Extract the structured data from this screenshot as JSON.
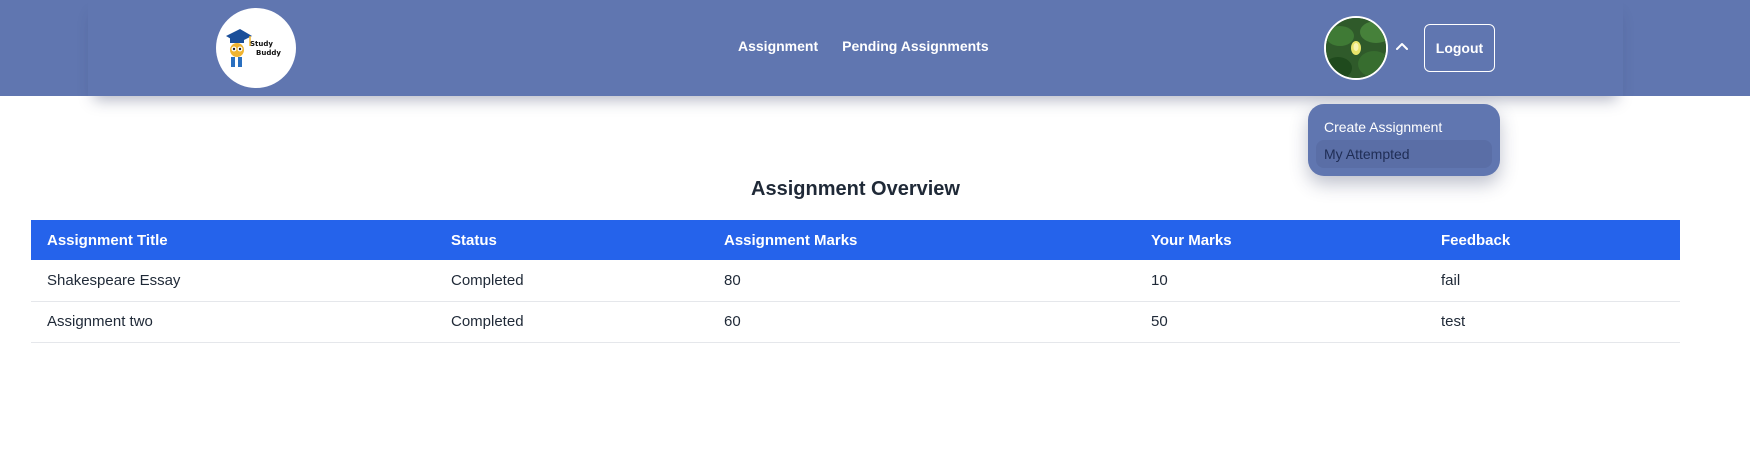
{
  "logo": {
    "line1": "Study",
    "line2": "Buddy",
    "icon": "graduation-cap-owl-icon"
  },
  "nav": {
    "links": [
      {
        "label": "Assignment"
      },
      {
        "label": "Pending Assignments"
      }
    ]
  },
  "user": {
    "avatar_icon": "user-avatar-photo",
    "chevron_icon": "chevron-up-icon",
    "logout_label": "Logout"
  },
  "dropdown": {
    "items": [
      {
        "label": "Create Assignment"
      },
      {
        "label": "My Attempted"
      }
    ]
  },
  "page": {
    "title": "Assignment Overview"
  },
  "table": {
    "headers": [
      "Assignment Title",
      "Status",
      "Assignment Marks",
      "Your Marks",
      "Feedback"
    ],
    "rows": [
      [
        "Shakespeare Essay",
        "Completed",
        "80",
        "10",
        "fail"
      ],
      [
        "Assignment two",
        "Completed",
        "60",
        "50",
        "test"
      ]
    ]
  },
  "colors": {
    "navbar": "#6076b0",
    "table_header": "#2563eb",
    "dropdown_active": "#5a6ea6"
  }
}
